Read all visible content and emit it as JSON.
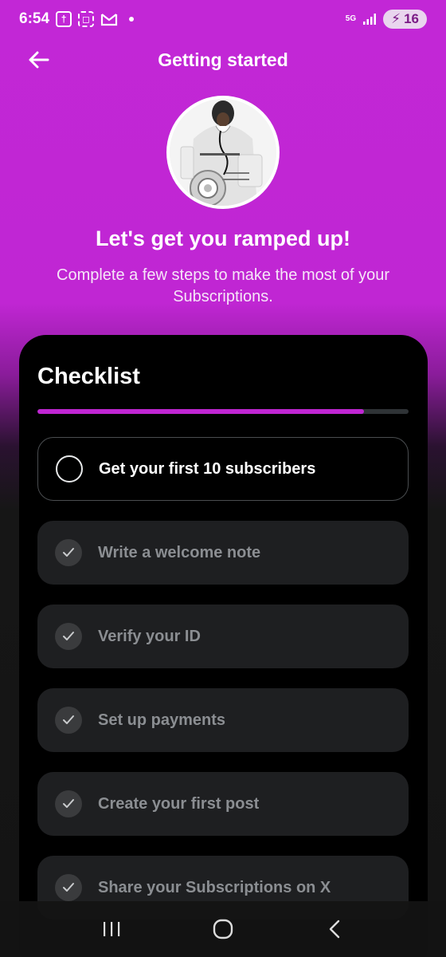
{
  "status_bar": {
    "time": "6:54",
    "network": "5G",
    "battery": "16"
  },
  "header": {
    "title": "Getting started"
  },
  "hero": {
    "title": "Let's get you ramped up!",
    "subtitle": "Complete a few steps to make the most of your Subscriptions."
  },
  "checklist": {
    "title": "Checklist",
    "progress": 0.88,
    "tasks": [
      {
        "label": "Get your first 10 subscribers",
        "completed": false
      },
      {
        "label": "Write a welcome note",
        "completed": true
      },
      {
        "label": "Verify your ID",
        "completed": true
      },
      {
        "label": "Set up payments",
        "completed": true
      },
      {
        "label": "Create your first post",
        "completed": true
      },
      {
        "label": "Share your Subscriptions on X",
        "completed": true
      }
    ]
  },
  "colors": {
    "accent": "#c026d3",
    "card": "#000000",
    "task_done_bg": "#1e1f21"
  },
  "icons": {
    "back": "arrow-left-icon",
    "check": "check-icon",
    "nav_recents": "recents-icon",
    "nav_home": "home-icon",
    "nav_back": "chevron-left-icon"
  }
}
